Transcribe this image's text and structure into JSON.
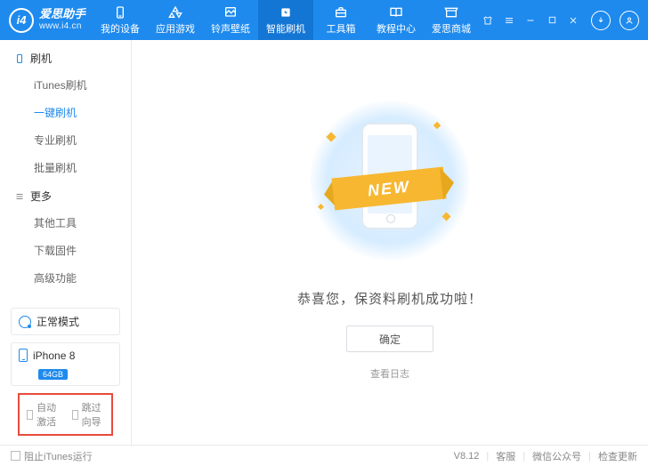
{
  "brand": {
    "logo": "i4",
    "name": "爱思助手",
    "url": "www.i4.cn"
  },
  "nav": {
    "items": [
      {
        "label": "我的设备"
      },
      {
        "label": "应用游戏"
      },
      {
        "label": "铃声壁纸"
      },
      {
        "label": "智能刷机"
      },
      {
        "label": "工具箱"
      },
      {
        "label": "教程中心"
      },
      {
        "label": "爱思商城"
      }
    ]
  },
  "sidebar": {
    "flash": {
      "header": "刷机",
      "items": [
        "iTunes刷机",
        "一键刷机",
        "专业刷机",
        "批量刷机"
      ]
    },
    "more": {
      "header": "更多",
      "items": [
        "其他工具",
        "下载固件",
        "高级功能"
      ]
    },
    "mode": "正常模式",
    "device": {
      "name": "iPhone 8",
      "storage": "64GB"
    },
    "checkboxes": {
      "auto_activate": "自动激活",
      "skip_guide": "跳过向导"
    }
  },
  "main": {
    "ribbon": "NEW",
    "success": "恭喜您，保资料刷机成功啦！",
    "ok": "确定",
    "log": "查看日志"
  },
  "footer": {
    "block_itunes": "阻止iTunes运行",
    "version": "V8.12",
    "support": "客服",
    "wechat": "微信公众号",
    "update": "检查更新"
  }
}
